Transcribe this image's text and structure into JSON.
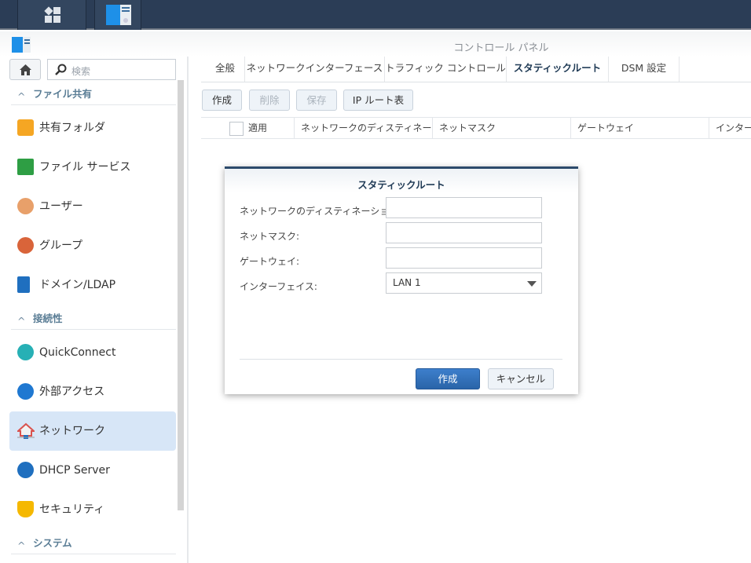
{
  "window": {
    "title": "コントロール パネル"
  },
  "search": {
    "placeholder": "検索"
  },
  "sidebar": {
    "sections": [
      {
        "label": "ファイル共有"
      },
      {
        "label": "接続性"
      },
      {
        "label": "システム"
      }
    ],
    "items": [
      {
        "label": "共有フォルダ",
        "icon": "shared-folder-icon",
        "color": "#f5a623"
      },
      {
        "label": "ファイル サービス",
        "icon": "file-services-icon",
        "color": "#2e9e44"
      },
      {
        "label": "ユーザー",
        "icon": "user-icon",
        "color": "#e8a06a"
      },
      {
        "label": "グループ",
        "icon": "group-icon",
        "color": "#d9643a"
      },
      {
        "label": "ドメイン/LDAP",
        "icon": "domain-ldap-icon",
        "color": "#1f6fbf"
      },
      {
        "label": "QuickConnect",
        "icon": "quickconnect-icon",
        "color": "#27b0b5"
      },
      {
        "label": "外部アクセス",
        "icon": "globe-icon",
        "color": "#1f78d1"
      },
      {
        "label": "ネットワーク",
        "icon": "network-home-icon",
        "color": "#d9534f"
      },
      {
        "label": "DHCP Server",
        "icon": "dhcp-icon",
        "color": "#1f6fbf"
      },
      {
        "label": "セキュリティ",
        "icon": "security-shield-icon",
        "color": "#f5b800"
      }
    ],
    "selected": "ネットワーク"
  },
  "tabs": [
    {
      "label": "全般"
    },
    {
      "label": "ネットワークインターフェース"
    },
    {
      "label": "トラフィック コントロール"
    },
    {
      "label": "スタティックルート"
    },
    {
      "label": "DSM 設定"
    }
  ],
  "active_tab": "スタティックルート",
  "toolbar": {
    "create": "作成",
    "delete": "削除",
    "save": "保存",
    "ip_route_table": "IP ルート表"
  },
  "table": {
    "columns": [
      "適用",
      "ネットワークのディスティネー...",
      "ネットマスク",
      "ゲートウェイ",
      "インターフ"
    ]
  },
  "dialog": {
    "title": "スタティックルート",
    "fields": [
      {
        "label": "ネットワークのディスティネーション:",
        "value": ""
      },
      {
        "label": "ネットマスク:",
        "value": ""
      },
      {
        "label": "ゲートウェイ:",
        "value": ""
      },
      {
        "label": "インターフェイス:",
        "value": "LAN 1"
      }
    ],
    "create": "作成",
    "cancel": "キャンセル"
  },
  "colors": {
    "accent": "#2f6db5",
    "taskbar": "#2b3d56",
    "selected": "#d7e6f7"
  }
}
